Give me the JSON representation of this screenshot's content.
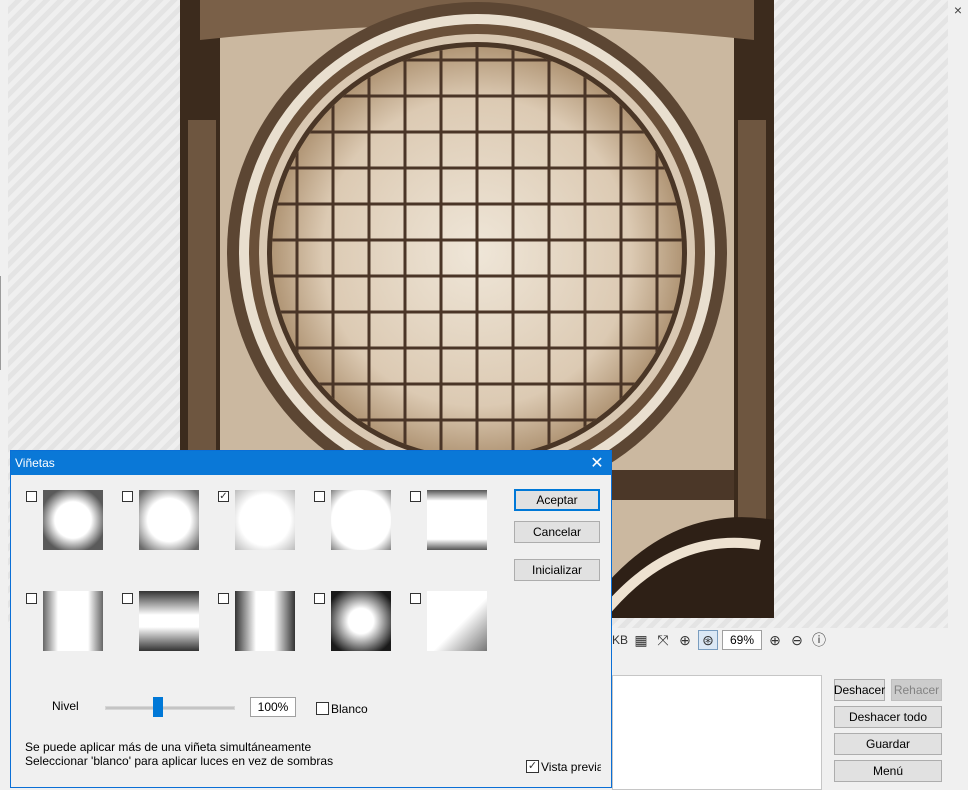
{
  "window": {
    "close_glyph": "×"
  },
  "toolbar": {
    "kb_label": "KB",
    "zoom_value": "69%",
    "icons": [
      "checkerboard-icon",
      "fit-icon",
      "actual-size-icon",
      "zoom-fit-icon",
      "zoom-in-icon",
      "zoom-out-icon",
      "info-icon"
    ]
  },
  "side_buttons": {
    "undo": "Deshacer",
    "redo": "Rehacer",
    "undo_all": "Deshacer todo",
    "save": "Guardar",
    "menu": "Menú"
  },
  "dialog": {
    "title": "Viñetas",
    "close": "✕",
    "accept": "Aceptar",
    "cancel": "Cancelar",
    "reset": "Inicializar",
    "level_label": "Nivel",
    "level_value": "100%",
    "white_label": "Blanco",
    "hint_1": "Se puede aplicar más de una viñeta simultáneamente",
    "hint_2": "Seleccionar 'blanco' para aplicar luces en vez de sombras",
    "preview_label": "Vista previa",
    "level_percent": 100,
    "slider_fraction": 0.4,
    "vignettes": [
      {
        "id": "circle-soft",
        "checked": false
      },
      {
        "id": "rounded-square",
        "checked": false
      },
      {
        "id": "square-faint",
        "checked": true
      },
      {
        "id": "corners",
        "checked": false
      },
      {
        "id": "top-bottom-curve",
        "checked": false
      },
      {
        "id": "oval-vertical",
        "checked": false
      },
      {
        "id": "horizontal-bands",
        "checked": false
      },
      {
        "id": "vertical-bands",
        "checked": false
      },
      {
        "id": "circle-dark",
        "checked": false
      },
      {
        "id": "diagonal",
        "checked": false
      }
    ],
    "white_checked": false,
    "preview_checked": true
  }
}
